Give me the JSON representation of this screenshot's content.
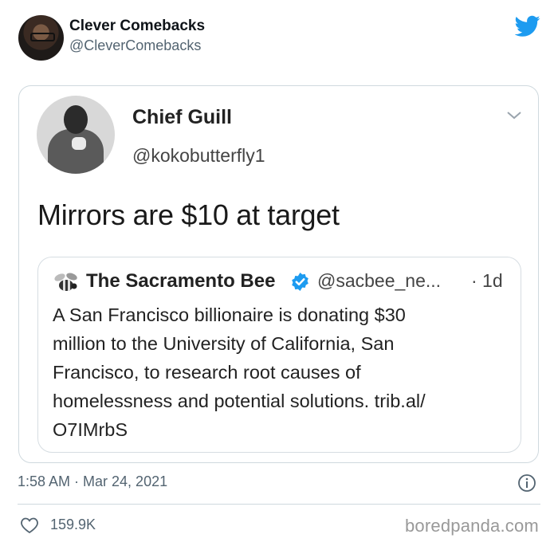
{
  "tweet": {
    "author_name": "Clever Comebacks",
    "author_handle": "@CleverComebacks",
    "timestamp": "1:58 AM · Mar 24, 2021",
    "likes": "159.9K"
  },
  "screenshot": {
    "author_name": "Chief Guill",
    "author_handle": "@kokobutterfly1",
    "text": "Mirrors are $10 at target",
    "quote": {
      "author_name": "The Sacramento Bee",
      "author_handle": "@sacbee_ne...",
      "age": "· 1d",
      "text_lines": [
        "A San Francisco billionaire is donating $30",
        "million to the University of California, San",
        "Francisco, to research root causes of",
        "homelessness and potential solutions. trib.al/",
        "O7IMrbS"
      ]
    }
  },
  "watermark": "boredpanda.com",
  "colors": {
    "twitter_blue": "#1d9bf0",
    "text": "#0f1419",
    "secondary_text": "#536471",
    "border": "#cfd9de"
  }
}
